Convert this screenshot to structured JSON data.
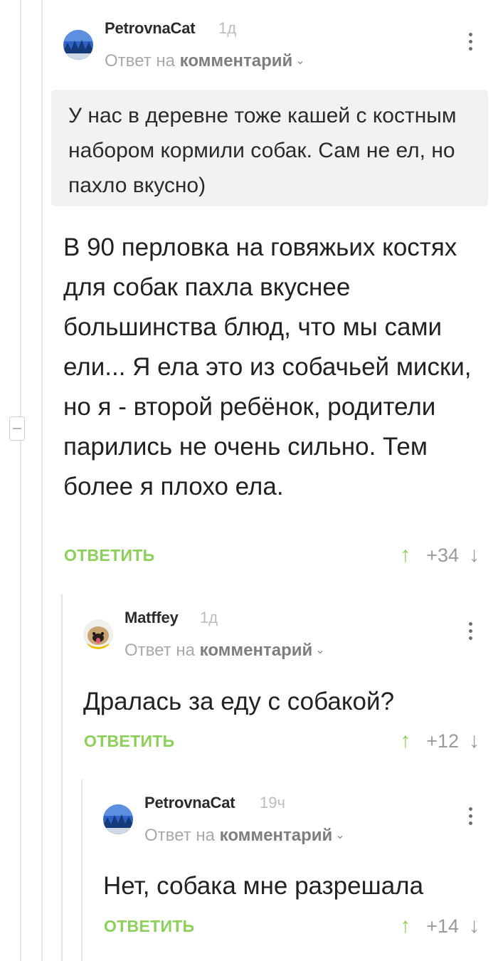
{
  "comments": [
    {
      "author": "PetrovnaCat",
      "time": "1д",
      "reply_prefix": "Ответ на",
      "reply_link": "комментарий",
      "quote": "У нас в деревне тоже кашей с костным набором кормили собак. Сам не ел, но пахло вкусно)",
      "text": "В 90 перловка на говяжьих костях для собак пахла вкуснее большинства блюд, что мы сами ели... Я ела это из собачьей миски, но я - второй ребёнок, родители парились не очень сильно. Тем более я плохо ела.",
      "reply_label": "ОТВЕТИТЬ",
      "score": "+34"
    },
    {
      "author": "Matffey",
      "time": "1д",
      "reply_prefix": "Ответ на",
      "reply_link": "комментарий",
      "text": "Дралась за еду с собакой?",
      "reply_label": "ОТВЕТИТЬ",
      "score": "+12"
    },
    {
      "author": "PetrovnaCat",
      "time": "19ч",
      "reply_prefix": "Ответ на",
      "reply_link": "комментарий",
      "text": "Нет, собака мне разрешала",
      "reply_label": "ОТВЕТИТЬ",
      "score": "+14"
    }
  ],
  "icons": {
    "more": "kebab-menu-icon",
    "upvote": "arrow-up-icon",
    "downvote": "arrow-down-icon",
    "collapse": "minus-icon",
    "reply_chevron": "chevron-down-icon"
  },
  "colors": {
    "accent_green": "#8ccf5a",
    "quote_bg": "#f2f2f2",
    "thread_line": "#e3e3e3"
  }
}
